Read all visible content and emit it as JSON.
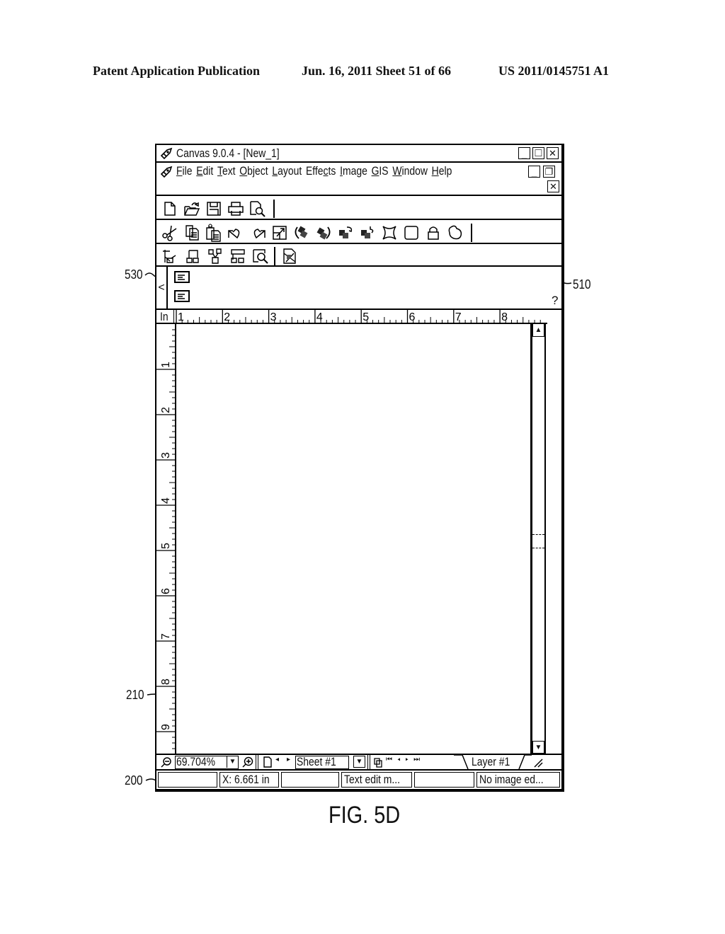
{
  "patent_header": {
    "publication": "Patent Application Publication",
    "date_sheet": "Jun. 16, 2011  Sheet 51 of 66",
    "number": "US 2011/0145751 A1"
  },
  "figure_label": "FIG. 5D",
  "reference_numerals": {
    "r530": "530",
    "r510": "510",
    "r210": "210",
    "r200": "200"
  },
  "window": {
    "title": "Canvas 9.0.4 - [New_1]",
    "controls": {
      "minimize": "_",
      "maximize": "□",
      "close": "✕"
    },
    "doc_controls": {
      "minimize": "_",
      "restore": "❐",
      "close": "✕"
    }
  },
  "menu": {
    "items": [
      {
        "hot": "F",
        "rest": "ile"
      },
      {
        "hot": "E",
        "rest": "dit"
      },
      {
        "hot": "T",
        "rest": "ext"
      },
      {
        "hot": "O",
        "rest": "bject"
      },
      {
        "hot": "L",
        "rest": "ayout"
      },
      {
        "pre": "Effe",
        "hot": "c",
        "rest": "ts"
      },
      {
        "hot": "I",
        "rest": "mage"
      },
      {
        "hot": "G",
        "rest": "IS"
      },
      {
        "hot": "W",
        "rest": "indow"
      },
      {
        "hot": "H",
        "rest": "elp"
      }
    ]
  },
  "toolbar_standard": [
    "new-document",
    "open-folder",
    "save-disk",
    "print",
    "print-preview"
  ],
  "toolbar_edit": [
    "cut-scissors",
    "copy",
    "paste",
    "undo",
    "redo",
    "transform",
    "rotate-left-stack",
    "rotate-right-stack",
    "flip-stack",
    "flip-alt-stack",
    "free-transform",
    "rectangle",
    "lock",
    "smooth-shape"
  ],
  "toolbar_layout": [
    "align-grid",
    "group",
    "ungroup-tree",
    "arrange",
    "zoom-view",
    "image-tool"
  ],
  "properties_bar": {
    "collapse": "<",
    "help": "?"
  },
  "ruler": {
    "unit": "In",
    "h_labels": [
      "1",
      "2",
      "3",
      "4",
      "5",
      "6",
      "7",
      "8"
    ],
    "v_labels": [
      "1",
      "2",
      "3",
      "4",
      "5",
      "6",
      "7",
      "8",
      "9"
    ]
  },
  "navbar": {
    "zoom_value": "69.704%",
    "sheet_value": "Sheet #1",
    "layer_tab": "Layer #1"
  },
  "statusbar": {
    "coords": "X: 6.661 in",
    "blank1": "",
    "mode": "Text edit m...",
    "blank2": "",
    "image_status": "No image ed..."
  }
}
